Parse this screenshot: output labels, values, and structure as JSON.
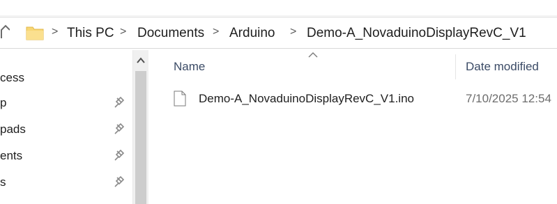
{
  "breadcrumb": {
    "items": [
      "This PC",
      "Documents",
      "Arduino",
      "Demo-A_NovaduinoDisplayRevC_V1"
    ],
    "separator": ">"
  },
  "nav": {
    "items": [
      {
        "label": "cess",
        "pinned": false
      },
      {
        "label": "p",
        "pinned": true
      },
      {
        "label": "pads",
        "pinned": true
      },
      {
        "label": "ents",
        "pinned": true
      },
      {
        "label": "s",
        "pinned": true
      }
    ]
  },
  "columns": {
    "name": "Name",
    "date_modified": "Date modified"
  },
  "files": [
    {
      "name": "Demo-A_NovaduinoDisplayRevC_V1.ino",
      "date_modified": "7/10/2025 12:54"
    }
  ],
  "colors": {
    "folder": "#f8d775",
    "header_text": "#3b4b66",
    "scroll_thumb": "#cdcdcd"
  },
  "icons": [
    "up-arrow-icon",
    "folder-icon",
    "pin-icon",
    "scroll-up-icon",
    "sort-ascending-icon",
    "document-icon"
  ]
}
